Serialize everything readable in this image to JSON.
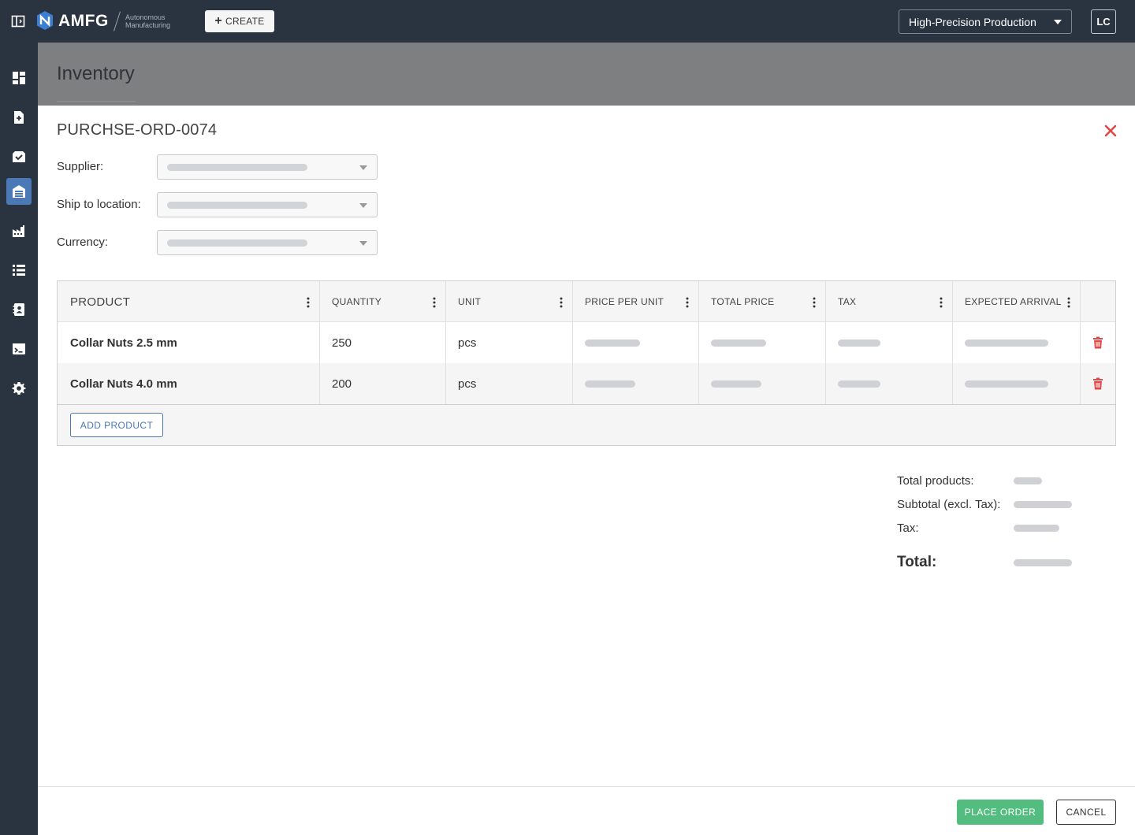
{
  "header": {
    "logo_text": "AMFG",
    "logo_sub_1": "Autonomous",
    "logo_sub_2": "Manufacturing",
    "create_label": "CREATE",
    "workspace": "High-Precision Production",
    "user_initials": "LC"
  },
  "sidebar": {
    "items": [
      {
        "icon": "dashboard-icon"
      },
      {
        "icon": "new-file-icon"
      },
      {
        "icon": "inbox-check-icon"
      },
      {
        "icon": "warehouse-icon",
        "active": true
      },
      {
        "icon": "factory-icon"
      },
      {
        "icon": "list-icon"
      },
      {
        "icon": "contacts-icon"
      },
      {
        "icon": "terminal-icon"
      },
      {
        "icon": "gear-icon"
      }
    ]
  },
  "page": {
    "title": "Inventory"
  },
  "modal": {
    "title": "PURCHSE-ORD-0074",
    "fields": {
      "supplier_label": "Supplier:",
      "ship_label": "Ship to location:",
      "currency_label": "Currency:"
    },
    "table": {
      "headers": [
        "PRODUCT",
        "QUANTITY",
        "UNIT",
        "PRICE PER UNIT",
        "TOTAL PRICE",
        "TAX",
        "EXPECTED ARRIVAL"
      ],
      "rows": [
        {
          "product": "Collar Nuts 2.5 mm",
          "quantity": "250",
          "unit": "pcs"
        },
        {
          "product": "Collar Nuts 4.0 mm",
          "quantity": "200",
          "unit": "pcs"
        }
      ],
      "add_product_label": "ADD PRODUCT"
    },
    "totals": {
      "total_products_label": "Total products:",
      "subtotal_label": "Subtotal (excl. Tax):",
      "tax_label": "Tax:",
      "total_label": "Total:"
    },
    "footer": {
      "place_order_label": "PLACE ORDER",
      "cancel_label": "CANCEL"
    }
  },
  "colors": {
    "topbar": "#2a3440",
    "accent_blue": "#4a79b5",
    "success_green": "#53bd7f",
    "danger_red": "#e04848"
  }
}
